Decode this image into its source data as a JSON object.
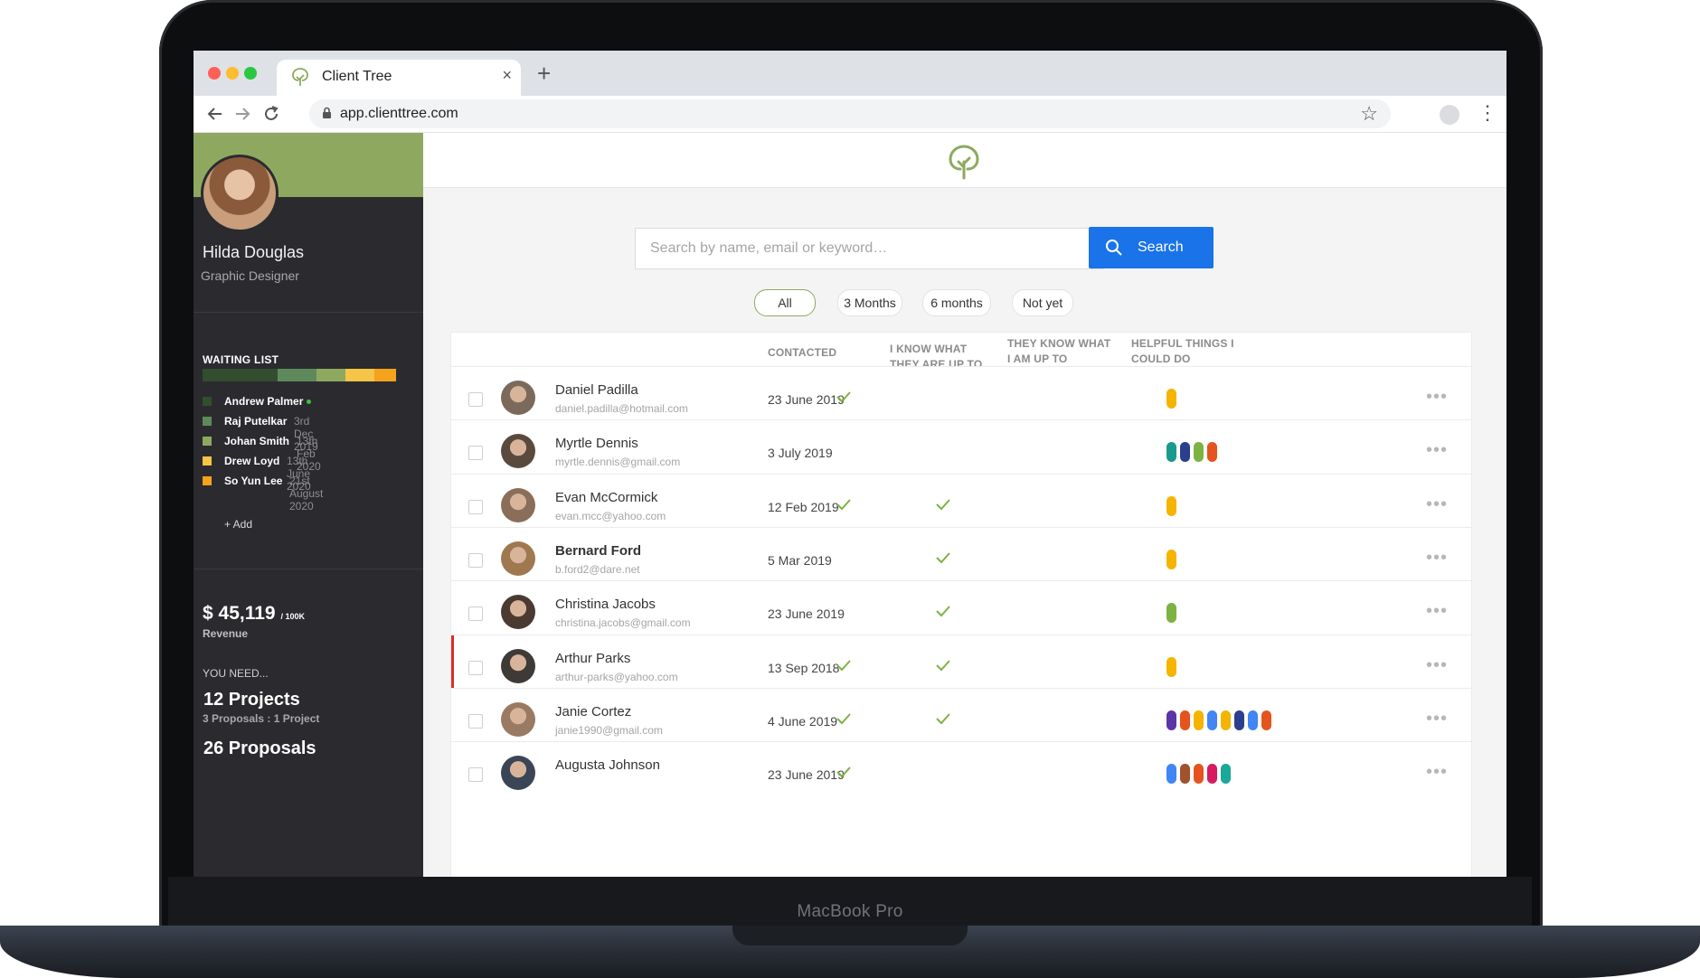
{
  "device": {
    "brand": "MacBook Pro"
  },
  "browser": {
    "tab_title": "Client Tree",
    "url": "app.clienttree.com",
    "icons": [
      "tree-icon",
      "close-icon",
      "plus-icon",
      "back-arrow-icon",
      "forward-arrow-icon",
      "reload-icon",
      "lock-icon",
      "star-icon",
      "kebab-icon"
    ]
  },
  "profile": {
    "name": "Hilda Douglas",
    "role": "Graphic Designer"
  },
  "waiting_list": {
    "title": "WAITING LIST",
    "bar_segments": [
      {
        "color": "#334d2f",
        "share": 0.39
      },
      {
        "color": "#5e8a5b",
        "share": 0.2
      },
      {
        "color": "#8ea95f",
        "share": 0.15
      },
      {
        "color": "#f6c447",
        "share": 0.15
      },
      {
        "color": "#f5a21c",
        "share": 0.11
      }
    ],
    "items": [
      {
        "name": "Andrew Palmer",
        "date": "",
        "color": "#334d2f",
        "online": true
      },
      {
        "name": "Raj Putelkar",
        "date": "3rd Dec 2019",
        "color": "#5e8a5b",
        "online": false
      },
      {
        "name": "Johan Smith",
        "date": "13th Feb 2020",
        "color": "#8ea95f",
        "online": false
      },
      {
        "name": "Drew Loyd",
        "date": "13th June 2020",
        "color": "#f6c447",
        "online": false
      },
      {
        "name": "So Yun Lee",
        "date": "21st August 2020",
        "color": "#f5a21c",
        "online": false
      }
    ],
    "add_label": "+ Add"
  },
  "revenue": {
    "amount": "$ 45,119",
    "target": "/ 100K",
    "label": "Revenue"
  },
  "you_need": {
    "title": "YOU NEED...",
    "projects": "12 Projects",
    "projects_sub": "3 Proposals : 1 Project",
    "proposals": "26 Proposals"
  },
  "search": {
    "placeholder": "Search by name, email or keyword…",
    "button_label": "Search"
  },
  "filters": [
    {
      "label": "All",
      "active": true
    },
    {
      "label": "3 Months",
      "active": false
    },
    {
      "label": "6 months",
      "active": false
    },
    {
      "label": "Not yet",
      "active": false
    }
  ],
  "table": {
    "headers": {
      "contacted": "CONTACTED",
      "know_line1": "I KNOW WHAT",
      "know_line2": "THEY ARE UP TO",
      "they_know_line1": "THEY KNOW WHAT",
      "they_know_line2": "I AM UP TO",
      "helpful_line1": "HELPFUL THINGS I",
      "helpful_line2": "COULD DO"
    },
    "rows": [
      {
        "name": "Daniel Padilla",
        "email": "daniel.padilla@hotmail.com",
        "contacted": "23 June 2019",
        "i_know": true,
        "they_know": false,
        "helpful": [
          "#f5b400"
        ],
        "bold": false,
        "flag": false,
        "avatar": "#7b6a5c"
      },
      {
        "name": "Myrtle Dennis",
        "email": "myrtle.dennis@gmail.com",
        "contacted": "3 July 2019",
        "i_know": false,
        "they_know": false,
        "helpful": [
          "#1a9a8c",
          "#2b3f8f",
          "#7cb342",
          "#e5541e"
        ],
        "bold": false,
        "flag": false,
        "avatar": "#5a4a3e"
      },
      {
        "name": "Evan McCormick",
        "email": "evan.mcc@yahoo.com",
        "contacted": "12 Feb 2019",
        "i_know": true,
        "they_know": true,
        "helpful": [
          "#f5b400"
        ],
        "bold": false,
        "flag": false,
        "avatar": "#8a6e5a"
      },
      {
        "name": "Bernard Ford",
        "email": "b.ford2@dare.net",
        "contacted": "5 Mar 2019",
        "i_know": false,
        "they_know": true,
        "helpful": [
          "#f5b400"
        ],
        "bold": true,
        "flag": false,
        "avatar": "#a07850"
      },
      {
        "name": "Christina Jacobs",
        "email": "christina.jacobs@gmail.com",
        "contacted": "23 June 2019",
        "i_know": false,
        "they_know": true,
        "helpful": [
          "#7cb342"
        ],
        "bold": false,
        "flag": false,
        "avatar": "#4a3a32"
      },
      {
        "name": "Arthur Parks",
        "email": "arthur-parks@yahoo.com",
        "contacted": "13 Sep 2018",
        "i_know": true,
        "they_know": true,
        "helpful": [
          "#f5b400"
        ],
        "bold": false,
        "flag": true,
        "avatar": "#3e3a36"
      },
      {
        "name": "Janie Cortez",
        "email": "janie1990@gmail.com",
        "contacted": "4 June 2019",
        "i_know": true,
        "they_know": true,
        "helpful": [
          "#5c35a8",
          "#e5541e",
          "#f5b400",
          "#4285f4",
          "#f5b400",
          "#2b3f8f",
          "#4285f4",
          "#e5541e"
        ],
        "bold": false,
        "flag": false,
        "avatar": "#9a7a62"
      },
      {
        "name": "Augusta Johnson",
        "email": "",
        "contacted": "23 June 2019",
        "i_know": true,
        "they_know": false,
        "helpful": [
          "#4285f4",
          "#a0522d",
          "#e5541e",
          "#d81b60",
          "#1aa89a"
        ],
        "bold": false,
        "flag": false,
        "avatar": "#3a4656"
      }
    ]
  }
}
